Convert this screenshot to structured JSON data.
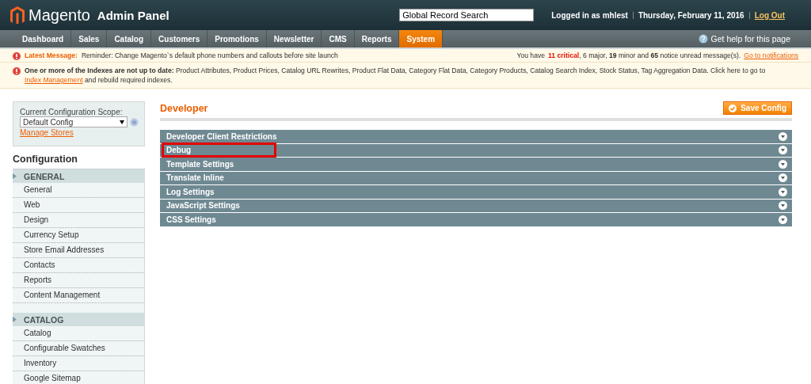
{
  "header": {
    "logo": "Magento",
    "subtitle": "Admin Panel",
    "search": {
      "value": "Global Record Search"
    },
    "user": "Logged in as mhlest",
    "date": "Thursday, February 11, 2016",
    "logout": "Log Out"
  },
  "nav": {
    "items": [
      {
        "label": "Dashboard",
        "selected": false
      },
      {
        "label": "Sales",
        "selected": false
      },
      {
        "label": "Catalog",
        "selected": false
      },
      {
        "label": "Customers",
        "selected": false
      },
      {
        "label": "Promotions",
        "selected": false
      },
      {
        "label": "Newsletter",
        "selected": false
      },
      {
        "label": "CMS",
        "selected": false
      },
      {
        "label": "Reports",
        "selected": false
      },
      {
        "label": "System",
        "selected": true
      }
    ],
    "help": "Get help for this page"
  },
  "latest_message": {
    "label": "Latest Message:",
    "text": "Reminder: Change Magento`s default phone numbers and callouts before site launch",
    "summary_before": "You have",
    "critical": "11 critical",
    "summary_after": ", 6 major, **19** minor and **65** notice unread message(s).",
    "link": "Go to notifications"
  },
  "index_message": {
    "text": "**One or more of the Indexes are not up to date:** Product Attributes, Product Prices, Catalog URL Rewrites, Product Flat Data, Category Flat Data, Category Products, Catalog Search Index, Stock Status, Tag Aggregation Data. Click here to go to",
    "link": "Index Management",
    "after": "and rebuild required indexes."
  },
  "sidebar": {
    "scope_label": "Current Configuration Scope:",
    "scope_value": "Default Config",
    "manage_stores": "Manage Stores",
    "title": "Configuration",
    "groups": [
      {
        "label": "GENERAL",
        "items": [
          "General",
          "Web",
          "Design",
          "Currency Setup",
          "Store Email Addresses",
          "Contacts",
          "Reports",
          "Content Management"
        ]
      },
      {
        "label": "CATALOG",
        "items": [
          "Catalog",
          "Configurable Swatches",
          "Inventory",
          "Google Sitemap"
        ]
      }
    ]
  },
  "main": {
    "title": "Developer",
    "save_button": "Save Config",
    "sections": [
      {
        "label": "Developer Client Restrictions",
        "highlighted": false
      },
      {
        "label": "Debug",
        "highlighted": true
      },
      {
        "label": "Template Settings",
        "highlighted": false
      },
      {
        "label": "Translate Inline",
        "highlighted": false
      },
      {
        "label": "Log Settings",
        "highlighted": false
      },
      {
        "label": "JavaScript Settings",
        "highlighted": false
      },
      {
        "label": "CSS Settings",
        "highlighted": false
      }
    ]
  }
}
